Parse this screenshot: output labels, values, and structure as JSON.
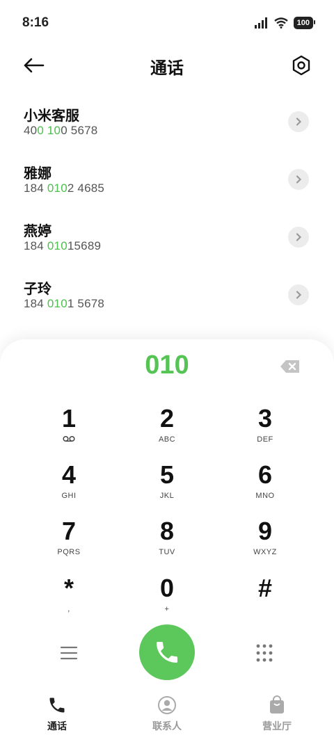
{
  "status": {
    "time": "8:16",
    "battery": "100"
  },
  "header": {
    "title": "通话"
  },
  "contacts": [
    {
      "name": "小米客服",
      "parts": [
        "40",
        "0",
        " ",
        "10",
        "0 5678"
      ],
      "hl": [
        false,
        true,
        false,
        true,
        false
      ]
    },
    {
      "name": "雅娜",
      "parts": [
        "184 ",
        "010",
        "2 4685"
      ],
      "hl": [
        false,
        true,
        false
      ]
    },
    {
      "name": "燕婷",
      "parts": [
        "184 ",
        "010",
        "15689"
      ],
      "hl": [
        false,
        true,
        false
      ]
    },
    {
      "name": "子玲",
      "parts": [
        "184 ",
        "010",
        "1 5678"
      ],
      "hl": [
        false,
        true,
        false
      ]
    }
  ],
  "dialpad": {
    "input": "010",
    "keys": [
      {
        "digit": "1",
        "letters": "voicemail"
      },
      {
        "digit": "2",
        "letters": "ABC"
      },
      {
        "digit": "3",
        "letters": "DEF"
      },
      {
        "digit": "4",
        "letters": "GHI"
      },
      {
        "digit": "5",
        "letters": "JKL"
      },
      {
        "digit": "6",
        "letters": "MNO"
      },
      {
        "digit": "7",
        "letters": "PQRS"
      },
      {
        "digit": "8",
        "letters": "TUV"
      },
      {
        "digit": "9",
        "letters": "WXYZ"
      },
      {
        "digit": "*",
        "letters": ","
      },
      {
        "digit": "0",
        "letters": "+"
      },
      {
        "digit": "#",
        "letters": ""
      }
    ]
  },
  "nav": [
    {
      "label": "通话",
      "icon": "phone-icon",
      "active": true
    },
    {
      "label": "联系人",
      "icon": "person-icon",
      "active": false
    },
    {
      "label": "营业厅",
      "icon": "bag-icon",
      "active": false
    }
  ],
  "colors": {
    "accent": "#5cc75a",
    "highlight": "#4cbf4c"
  }
}
